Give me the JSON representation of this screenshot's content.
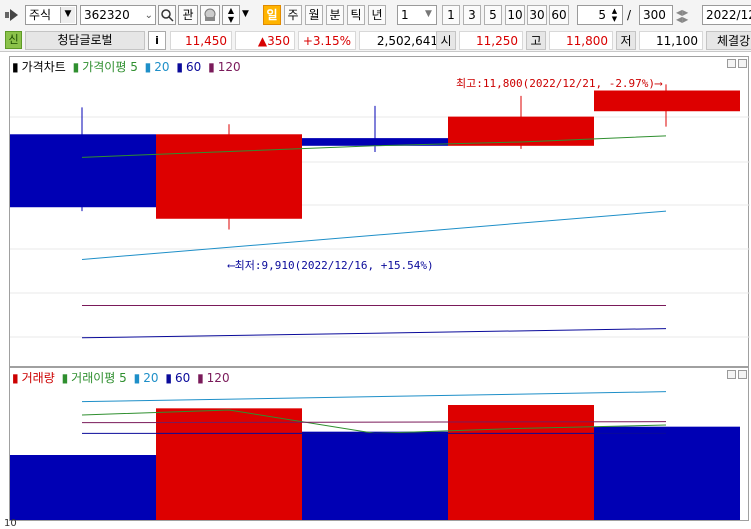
{
  "toolbar": {
    "market": "주식",
    "code": "362320",
    "interest_label": "관",
    "periods": [
      "일",
      "주",
      "월",
      "분",
      "틱",
      "년"
    ],
    "interval_value": "1",
    "quick_counts": [
      "1",
      "3",
      "5",
      "10",
      "30",
      "60"
    ],
    "view_count": "5",
    "separator": "/",
    "total_count": "300",
    "date": "2022/12/"
  },
  "info": {
    "badge": "신",
    "name": "청담글로벌",
    "info_button": "i",
    "price": "11,450",
    "change": "▲350",
    "change_pct": "+3.15%",
    "volume": "2,502,641",
    "open_label": "시",
    "open": "11,250",
    "high_label": "고",
    "high": "11,800",
    "low_label": "저",
    "low": "11,100",
    "exec_label": "체결강"
  },
  "price_panel": {
    "legend": [
      {
        "text": "가격차트",
        "color": "#000000"
      },
      {
        "text": "가격이평 5",
        "color": "#2f8f2f"
      },
      {
        "text": "20",
        "color": "#1e8fc8"
      },
      {
        "text": "60",
        "color": "#0a0a9a"
      },
      {
        "text": "120",
        "color": "#7a1a5a"
      }
    ],
    "high_annotation": "최고:11,800(2022/12/21, -2.97%)",
    "low_annotation": "최저:9,910(2022/12/16, +15.54%)"
  },
  "volume_panel": {
    "legend": [
      {
        "text": "거래량",
        "color": "#cc0000"
      },
      {
        "text": "거래이평 5",
        "color": "#2f8f2f"
      },
      {
        "text": "20",
        "color": "#1e8fc8"
      },
      {
        "text": "60",
        "color": "#0a0a9a"
      },
      {
        "text": "120",
        "color": "#7a1a5a"
      }
    ]
  },
  "bottom_label": "10",
  "chart_data": [
    {
      "type": "candlestick",
      "title": "가격차트",
      "candles": [
        {
          "open": 11150,
          "close": 10200,
          "high": 11500,
          "low": 10150,
          "direction": "down"
        },
        {
          "open": 10050,
          "close": 11150,
          "high": 11280,
          "low": 9910,
          "direction": "up"
        },
        {
          "open": 11100,
          "close": 11000,
          "high": 11520,
          "low": 10920,
          "direction": "down"
        },
        {
          "open": 11000,
          "close": 11380,
          "high": 11650,
          "low": 10960,
          "direction": "up"
        },
        {
          "open": 11450,
          "close": 11720,
          "high": 11800,
          "low": 11250,
          "direction": "up"
        }
      ],
      "series": [
        {
          "name": "가격이평 5",
          "color": "#2f8f2f",
          "values": [
            10850,
            null,
            11000,
            11050,
            11130
          ]
        },
        {
          "name": "20",
          "color": "#1e8fc8",
          "values": [
            9520,
            null,
            null,
            null,
            10150
          ]
        },
        {
          "name": "60",
          "color": "#7a1a5a",
          "values": [
            8920,
            null,
            null,
            null,
            8920
          ]
        },
        {
          "name": "120",
          "color": "#0a0a9a",
          "values": [
            8500,
            null,
            null,
            null,
            8620
          ]
        }
      ]
    },
    {
      "type": "bar",
      "title": "거래량",
      "values": [
        1950000,
        3350000,
        2650000,
        3450000,
        2800000
      ],
      "colors": [
        "#0000b4",
        "#dd0000",
        "#0000b4",
        "#dd0000",
        "#0000b4"
      ],
      "series": [
        {
          "name": "거래이평 5",
          "color": "#2f8f2f",
          "values": [
            3150000,
            3300000,
            2600000,
            2750000,
            2850000
          ]
        },
        {
          "name": "20",
          "color": "#1e8fc8",
          "values": [
            3550000,
            null,
            null,
            null,
            3850000
          ]
        },
        {
          "name": "60",
          "color": "#7a1a5a",
          "values": [
            2920000,
            null,
            null,
            null,
            2950000
          ]
        },
        {
          "name": "120",
          "color": "#0a0a9a",
          "values": [
            2600000,
            null,
            null,
            null,
            2600000
          ]
        }
      ]
    }
  ]
}
